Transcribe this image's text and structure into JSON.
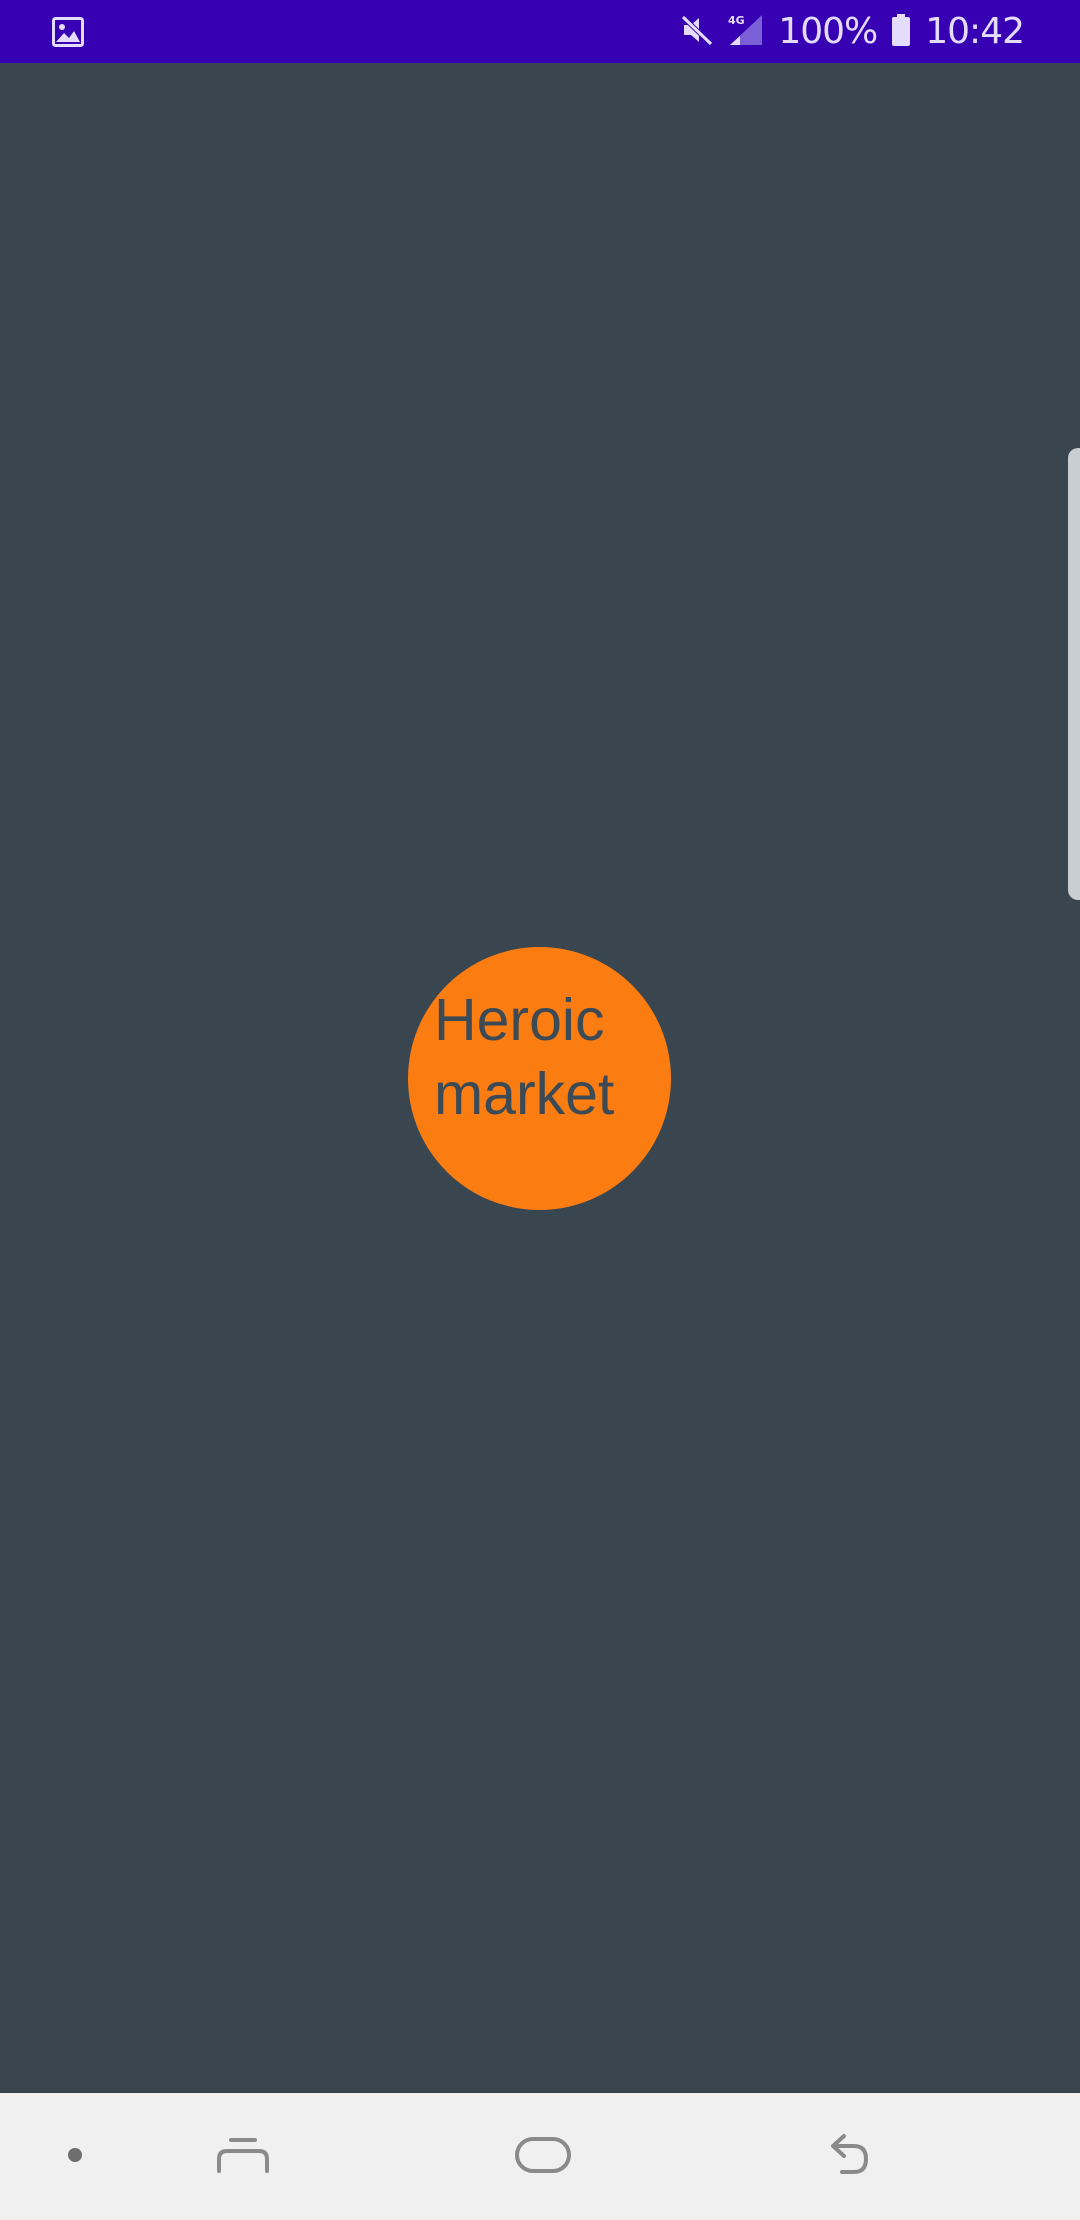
{
  "status_bar": {
    "left_icon": "image-icon",
    "mute_icon": "mute-icon",
    "signal_icon": "signal-4g-icon",
    "battery_percent": "100%",
    "battery_icon": "battery-icon",
    "time": "10:42",
    "background_color": "#3700b3"
  },
  "app": {
    "background_color": "#39454f",
    "logo": {
      "line1": "Heroic",
      "line2": "market",
      "circle_color": "#fb7d12",
      "text_color": "#3b4a55"
    },
    "edge_panel_handle": "edge-panel-handle"
  },
  "nav_bar": {
    "buttons": [
      {
        "name": "dot-indicator",
        "icon": "dot-icon"
      },
      {
        "name": "recent-apps",
        "icon": "recents-icon"
      },
      {
        "name": "home",
        "icon": "home-icon"
      },
      {
        "name": "back",
        "icon": "back-icon"
      }
    ],
    "background_color": "#f0f0f0"
  }
}
